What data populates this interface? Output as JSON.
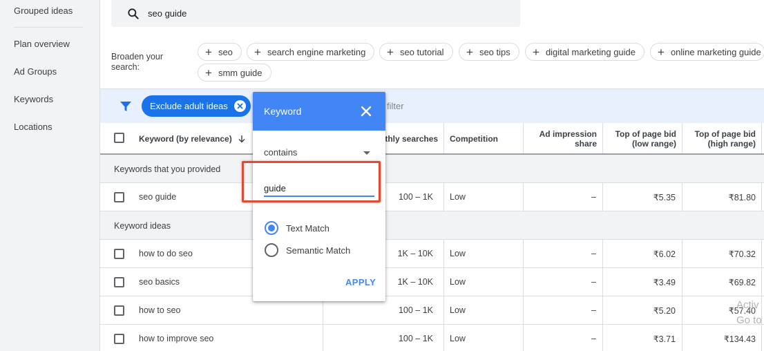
{
  "sidebar": {
    "items": [
      {
        "label": "Grouped ideas"
      },
      {
        "label": "Plan overview"
      },
      {
        "label": "Ad Groups"
      },
      {
        "label": "Keywords"
      },
      {
        "label": "Locations"
      }
    ]
  },
  "search": {
    "value": "seo guide",
    "icon": "search-icon"
  },
  "broaden": {
    "label": "Broaden your search:",
    "chips": [
      "seo",
      "search engine marketing",
      "seo tutorial",
      "seo tips",
      "digital marketing guide",
      "online marketing guide",
      "smm guide"
    ]
  },
  "filterbar": {
    "exclude_label": "Exclude adult ideas",
    "add_filter_label": "filter"
  },
  "table": {
    "headers": {
      "keyword": "Keyword (by relevance)",
      "monthly": "nthly searches",
      "competition": "Competition",
      "impression_line1": "Ad impression",
      "impression_line2": "share",
      "low_line1": "Top of page bid",
      "low_line2": "(low range)",
      "high_line1": "Top of page bid",
      "high_line2": "(high range)"
    },
    "sections": {
      "provided": "Keywords that you provided",
      "ideas": "Keyword ideas"
    },
    "provided_rows": [
      {
        "keyword": "seo guide",
        "searches": "100 – 1K",
        "competition": "Low",
        "impression": "–",
        "low": "₹5.35",
        "high": "₹81.80"
      }
    ],
    "idea_rows": [
      {
        "keyword": "how to do seo",
        "searches": "1K – 10K",
        "competition": "Low",
        "impression": "–",
        "low": "₹6.02",
        "high": "₹70.32"
      },
      {
        "keyword": "seo basics",
        "searches": "1K – 10K",
        "competition": "Low",
        "impression": "–",
        "low": "₹3.49",
        "high": "₹69.82"
      },
      {
        "keyword": "how to seo",
        "searches": "100 – 1K",
        "competition": "Low",
        "impression": "–",
        "low": "₹5.20",
        "high": "₹57.40"
      },
      {
        "keyword": "how to improve seo",
        "searches": "100 – 1K",
        "competition": "Low",
        "impression": "–",
        "low": "₹3.71",
        "high": "₹134.43"
      }
    ]
  },
  "popup": {
    "title": "Keyword",
    "operator": "contains",
    "input_value": "guide",
    "options": [
      {
        "label": "Text Match",
        "selected": true
      },
      {
        "label": "Semantic Match",
        "selected": false
      }
    ],
    "apply_label": "APPLY"
  },
  "watermark": {
    "line1": "Activ",
    "line2": "Go to"
  },
  "colors": {
    "accent": "#1a73e8",
    "popup_header": "#4285f4",
    "highlight": "#e04b36",
    "filter_bar": "#e8f0fe"
  }
}
